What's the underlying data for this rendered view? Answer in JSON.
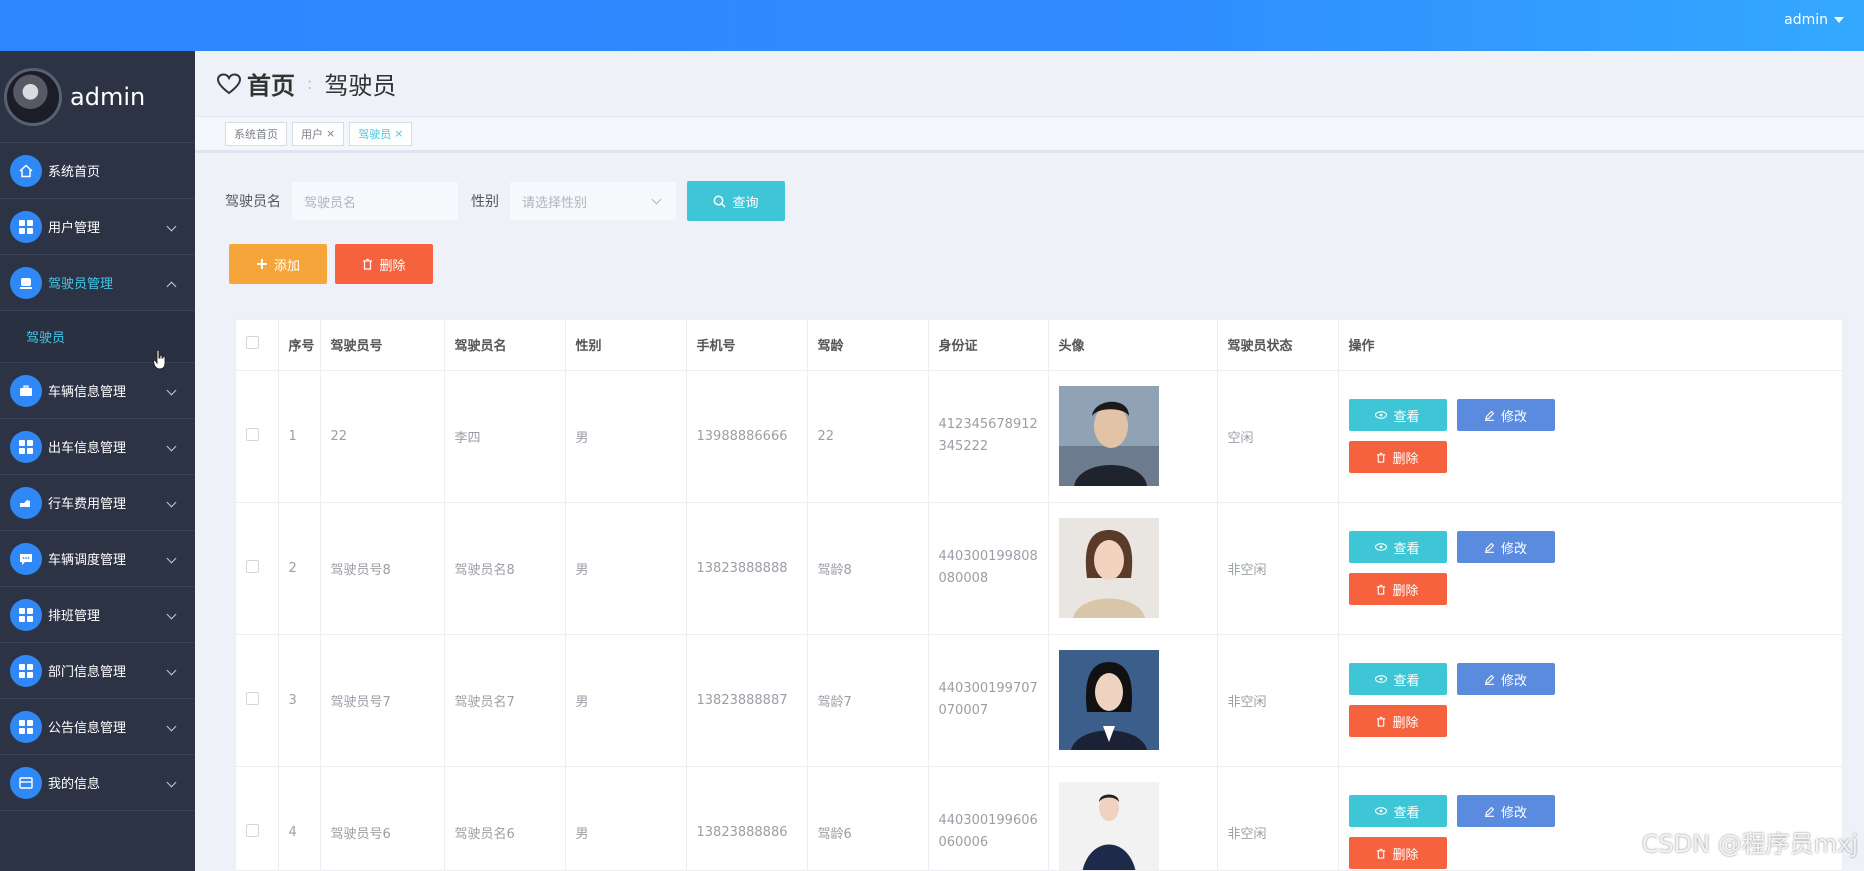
{
  "topbar": {
    "username": "admin"
  },
  "sidebar": {
    "profile_name": "admin",
    "items": [
      {
        "label": "系统首页",
        "icon": "home-icon"
      },
      {
        "label": "用户管理",
        "icon": "grid-icon"
      },
      {
        "label": "驾驶员管理",
        "icon": "driver-icon",
        "expanded": true
      },
      {
        "label": "车辆信息管理",
        "icon": "briefcase-icon"
      },
      {
        "label": "出车信息管理",
        "icon": "grid-icon"
      },
      {
        "label": "行车费用管理",
        "icon": "payment-icon"
      },
      {
        "label": "车辆调度管理",
        "icon": "chat-icon"
      },
      {
        "label": "排班管理",
        "icon": "grid-icon"
      },
      {
        "label": "部门信息管理",
        "icon": "grid-icon"
      },
      {
        "label": "公告信息管理",
        "icon": "grid-icon"
      },
      {
        "label": "我的信息",
        "icon": "card-icon"
      }
    ],
    "sub_item": "驾驶员"
  },
  "breadcrumb": {
    "home": "首页",
    "separator": ":",
    "current": "驾驶员"
  },
  "tabs": [
    {
      "label": "系统首页",
      "closable": false
    },
    {
      "label": "用户",
      "closable": true
    },
    {
      "label": "驾驶员",
      "closable": true,
      "active": true
    }
  ],
  "tab_close": "×",
  "filter": {
    "name_label": "驾驶员名",
    "name_placeholder": "驾驶员名",
    "gender_label": "性别",
    "gender_placeholder": "请选择性别",
    "search_label": "查询"
  },
  "actions": {
    "add_label": "添加",
    "delete_label": "删除"
  },
  "table": {
    "columns": [
      "序号",
      "驾驶员号",
      "驾驶员名",
      "性别",
      "手机号",
      "驾龄",
      "身份证",
      "头像",
      "驾驶员状态",
      "操作"
    ],
    "rows": [
      {
        "index": "1",
        "driver_no": "22",
        "name": "李四",
        "gender": "男",
        "phone": "13988886666",
        "years": "22",
        "id_card": "412345678912345222",
        "status": "空闲"
      },
      {
        "index": "2",
        "driver_no": "驾驶员号8",
        "name": "驾驶员名8",
        "gender": "男",
        "phone": "13823888888",
        "years": "驾龄8",
        "id_card": "440300199808080008",
        "status": "非空闲"
      },
      {
        "index": "3",
        "driver_no": "驾驶员号7",
        "name": "驾驶员名7",
        "gender": "男",
        "phone": "13823888887",
        "years": "驾龄7",
        "id_card": "440300199707070007",
        "status": "非空闲"
      },
      {
        "index": "4",
        "driver_no": "驾驶员号6",
        "name": "驾驶员名6",
        "gender": "男",
        "phone": "13823888886",
        "years": "驾龄6",
        "id_card": "440300199606060006",
        "status": "非空闲"
      }
    ],
    "op_view": "查看",
    "op_edit": "修改",
    "op_delete": "删除"
  },
  "watermark": "CSDN @程序员mxj",
  "colors": {
    "topbar": "#2e86ff",
    "sidebar": "#2c3345",
    "accent": "#43c6e6",
    "add": "#f5a53a",
    "danger": "#f5623d",
    "edit": "#5b8bde"
  }
}
